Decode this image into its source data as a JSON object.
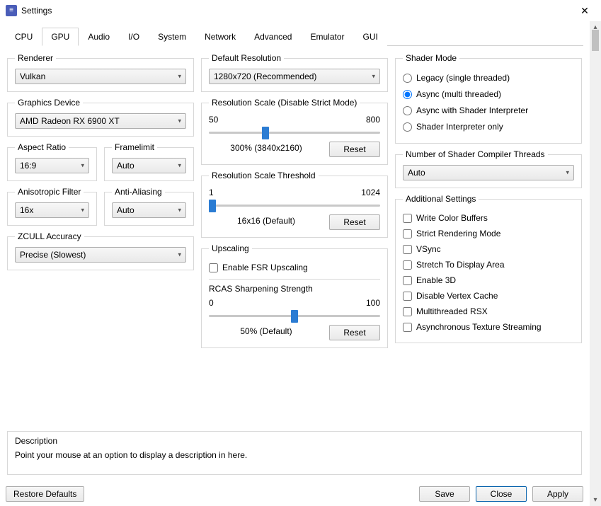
{
  "window": {
    "title": "Settings"
  },
  "tabs": [
    "CPU",
    "GPU",
    "Audio",
    "I/O",
    "System",
    "Network",
    "Advanced",
    "Emulator",
    "GUI"
  ],
  "active_tab": "GPU",
  "left": {
    "renderer": {
      "label": "Renderer",
      "value": "Vulkan"
    },
    "graphics_device": {
      "label": "Graphics Device",
      "value": "AMD Radeon RX 6900 XT"
    },
    "aspect_ratio": {
      "label": "Aspect Ratio",
      "value": "16:9"
    },
    "framelimit": {
      "label": "Framelimit",
      "value": "Auto"
    },
    "aniso": {
      "label": "Anisotropic Filter",
      "value": "16x"
    },
    "aa": {
      "label": "Anti-Aliasing",
      "value": "Auto"
    },
    "zcull": {
      "label": "ZCULL Accuracy",
      "value": "Precise (Slowest)"
    }
  },
  "mid": {
    "default_res": {
      "label": "Default Resolution",
      "value": "1280x720 (Recommended)"
    },
    "res_scale": {
      "label": "Resolution Scale (Disable Strict Mode)",
      "min": "50",
      "max": "800",
      "pos_percent": 33,
      "caption": "300% (3840x2160)",
      "reset": "Reset"
    },
    "res_thresh": {
      "label": "Resolution Scale Threshold",
      "min": "1",
      "max": "1024",
      "pos_percent": 1,
      "caption": "16x16 (Default)",
      "reset": "Reset"
    },
    "upscaling": {
      "label": "Upscaling",
      "fsr": "Enable FSR Upscaling",
      "rcas_label": "RCAS Sharpening Strength",
      "min": "0",
      "max": "100",
      "pos_percent": 50,
      "caption": "50% (Default)",
      "reset": "Reset"
    }
  },
  "right": {
    "shader_mode": {
      "label": "Shader Mode",
      "options": [
        {
          "label": "Legacy (single threaded)",
          "selected": false
        },
        {
          "label": "Async (multi threaded)",
          "selected": true
        },
        {
          "label": "Async with Shader Interpreter",
          "selected": false
        },
        {
          "label": "Shader Interpreter only",
          "selected": false
        }
      ]
    },
    "compiler_threads": {
      "label": "Number of Shader Compiler Threads",
      "value": "Auto"
    },
    "additional": {
      "label": "Additional Settings",
      "items": [
        "Write Color Buffers",
        "Strict Rendering Mode",
        "VSync",
        "Stretch To Display Area",
        "Enable 3D",
        "Disable Vertex Cache",
        "Multithreaded RSX",
        "Asynchronous Texture Streaming"
      ]
    }
  },
  "description": {
    "label": "Description",
    "text": "Point your mouse at an option to display a description in here."
  },
  "footer": {
    "restore": "Restore Defaults",
    "save": "Save",
    "close": "Close",
    "apply": "Apply"
  }
}
